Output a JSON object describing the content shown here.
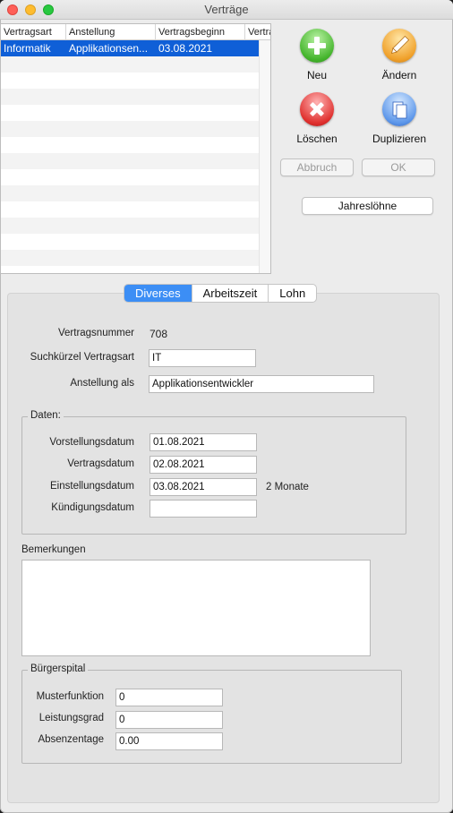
{
  "window": {
    "title": "Verträge"
  },
  "table": {
    "columns": [
      "Vertragsart",
      "Anstellung",
      "Vertragsbeginn",
      "Vertra"
    ],
    "rows": [
      {
        "vertragsart": "Informatik",
        "anstellung": "Applikationsen...",
        "vertragsbeginn": "03.08.2021",
        "selected": true
      }
    ]
  },
  "toolbar": {
    "new_label": "Neu",
    "edit_label": "Ändern",
    "delete_label": "Löschen",
    "duplicate_label": "Duplizieren",
    "cancel_label": "Abbruch",
    "ok_label": "OK",
    "annual_wages_label": "Jahreslöhne"
  },
  "tabs": [
    {
      "label": "Diverses",
      "active": true
    },
    {
      "label": "Arbeitszeit",
      "active": false
    },
    {
      "label": "Lohn",
      "active": false
    }
  ],
  "form": {
    "contract_number_label": "Vertragsnummer",
    "contract_number": "708",
    "short_label": "Suchkürzel Vertragsart",
    "short_value": "IT",
    "employment_label": "Anstellung als",
    "employment_value": "Applikationsentwickler",
    "dates_group": "Daten:",
    "interview_label": "Vorstellungsdatum",
    "interview_value": "01.08.2021",
    "contract_date_label": "Vertragsdatum",
    "contract_date_value": "02.08.2021",
    "hire_label": "Einstellungsdatum",
    "hire_value": "03.08.2021",
    "hire_note": "2 Monate",
    "termination_label": "Kündigungsdatum",
    "termination_value": "",
    "remarks_label": "Bemerkungen",
    "remarks_value": "",
    "hospital_group": "Bürgerspital",
    "model_function_label": "Musterfunktion",
    "model_function_value": "0",
    "performance_label": "Leistungsgrad",
    "performance_value": "0",
    "absence_label": "Absenzentage",
    "absence_value": "0.00"
  },
  "colors": {
    "selection": "#0f5fd7",
    "active_tab": "#3c8ef5"
  },
  "icons": {
    "new": "plus-icon",
    "edit": "pencil-icon",
    "delete": "x-icon",
    "duplicate": "copy-icon"
  }
}
